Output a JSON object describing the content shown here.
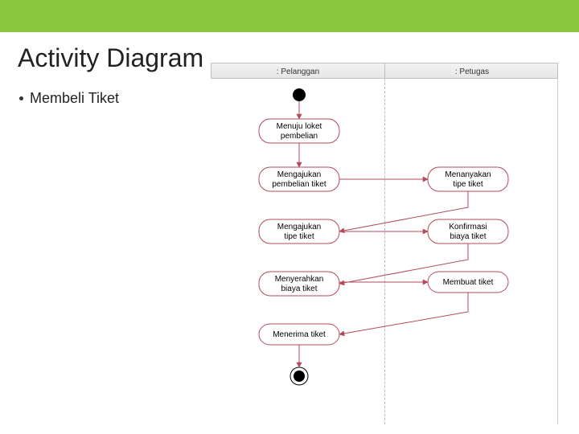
{
  "header": {
    "green_bar": true
  },
  "title": "Activity Diagram",
  "bullet": "Membeli Tiket",
  "swimlanes": {
    "left": ": Pelanggan",
    "right": ": Petugas"
  },
  "activities": {
    "a1_l1": "Menuju loket",
    "a1_l2": "pembelian",
    "a2_l1": "Mengajukan",
    "a2_l2": "pembelian tiket",
    "a3_l1": "Menanyakan",
    "a3_l2": "tipe tiket",
    "a4_l1": "Mengajukan",
    "a4_l2": "tipe tiket",
    "a5_l1": "Konfirmasi",
    "a5_l2": "biaya tiket",
    "a6_l1": "Menyerahkan",
    "a6_l2": "biaya tiket",
    "a7": "Membuat tiket",
    "a8": "Menerima tiket"
  }
}
